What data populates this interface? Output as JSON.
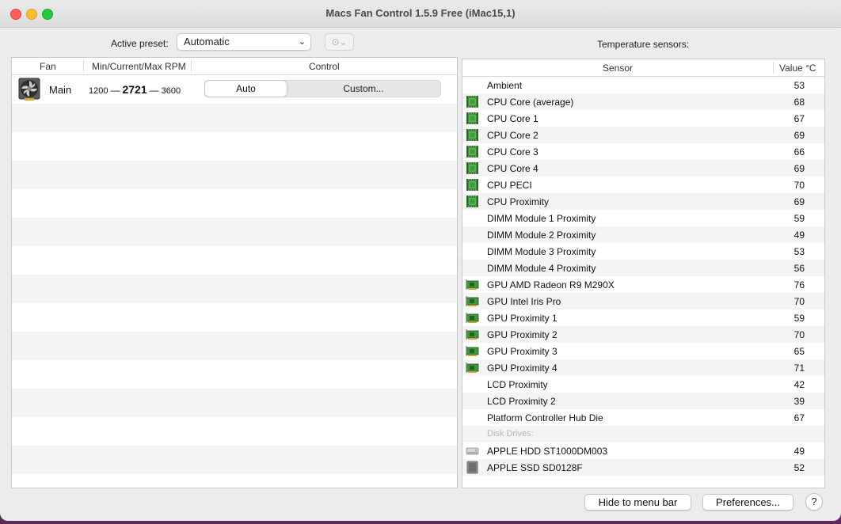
{
  "window": {
    "title": "Macs Fan Control 1.5.9 Free (iMac15,1)"
  },
  "preset": {
    "label": "Active preset:",
    "value": "Automatic",
    "more_icon": "ellipsis-circle-icon"
  },
  "fans": {
    "columns": [
      "Fan",
      "Min/Current/Max RPM",
      "Control"
    ],
    "rows": [
      {
        "name": "Main",
        "min": "1200",
        "current": "2721",
        "max": "3600",
        "control_auto": "Auto",
        "control_custom": "Custom..."
      }
    ]
  },
  "sensors": {
    "title": "Temperature sensors:",
    "columns": [
      "Sensor",
      "Value °C"
    ],
    "rows": [
      {
        "name": "Ambient",
        "value": "53",
        "icon": "none"
      },
      {
        "name": "CPU Core (average)",
        "value": "68",
        "icon": "cpu"
      },
      {
        "name": "CPU Core 1",
        "value": "67",
        "icon": "cpu"
      },
      {
        "name": "CPU Core 2",
        "value": "69",
        "icon": "cpu"
      },
      {
        "name": "CPU Core 3",
        "value": "66",
        "icon": "cpu"
      },
      {
        "name": "CPU Core 4",
        "value": "69",
        "icon": "cpu"
      },
      {
        "name": "CPU PECI",
        "value": "70",
        "icon": "cpu"
      },
      {
        "name": "CPU Proximity",
        "value": "69",
        "icon": "cpu"
      },
      {
        "name": "DIMM Module 1 Proximity",
        "value": "59",
        "icon": "none"
      },
      {
        "name": "DIMM Module 2 Proximity",
        "value": "49",
        "icon": "none"
      },
      {
        "name": "DIMM Module 3 Proximity",
        "value": "53",
        "icon": "none"
      },
      {
        "name": "DIMM Module 4 Proximity",
        "value": "56",
        "icon": "none"
      },
      {
        "name": "GPU AMD Radeon R9 M290X",
        "value": "76",
        "icon": "gpu"
      },
      {
        "name": "GPU Intel Iris Pro",
        "value": "70",
        "icon": "gpu"
      },
      {
        "name": "GPU Proximity 1",
        "value": "59",
        "icon": "gpu"
      },
      {
        "name": "GPU Proximity 2",
        "value": "70",
        "icon": "gpu"
      },
      {
        "name": "GPU Proximity 3",
        "value": "65",
        "icon": "gpu"
      },
      {
        "name": "GPU Proximity 4",
        "value": "71",
        "icon": "gpu"
      },
      {
        "name": "LCD Proximity",
        "value": "42",
        "icon": "none"
      },
      {
        "name": "LCD Proximity 2",
        "value": "39",
        "icon": "none"
      },
      {
        "name": "Platform Controller Hub Die",
        "value": "67",
        "icon": "none"
      },
      {
        "name": "Disk Drives:",
        "value": "",
        "icon": "none",
        "section": true
      },
      {
        "name": "APPLE HDD ST1000DM003",
        "value": "49",
        "icon": "hdd"
      },
      {
        "name": "APPLE SSD SD0128F",
        "value": "52",
        "icon": "ssd"
      }
    ]
  },
  "footer": {
    "hide_label": "Hide to menu bar",
    "prefs_label": "Preferences...",
    "help_label": "?"
  },
  "colors": {
    "close": "#fe5f57",
    "minimize": "#febc2e",
    "maximize": "#28c840",
    "chip_green": "#3f9a3a"
  }
}
